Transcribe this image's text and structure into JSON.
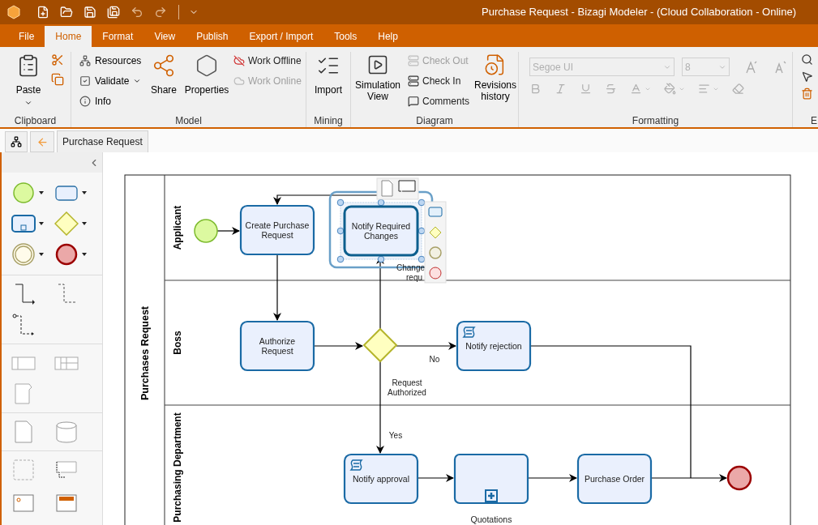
{
  "window": {
    "title": "Purchase Request - Bizagi Modeler - (Cloud Collaboration - Online)"
  },
  "menu_tabs": [
    {
      "label": "File",
      "selected": false
    },
    {
      "label": "Home",
      "selected": true
    },
    {
      "label": "Format",
      "selected": false
    },
    {
      "label": "View",
      "selected": false
    },
    {
      "label": "Publish",
      "selected": false
    },
    {
      "label": "Export / Import",
      "selected": false
    },
    {
      "label": "Tools",
      "selected": false
    },
    {
      "label": "Help",
      "selected": false
    }
  ],
  "ribbon": {
    "clipboard": {
      "label": "Clipboard",
      "paste": "Paste"
    },
    "model": {
      "label": "Model",
      "items": [
        {
          "label": "Resources"
        },
        {
          "label": "Validate"
        },
        {
          "label": "Info"
        }
      ],
      "share": "Share",
      "properties": "Properties",
      "work": [
        {
          "label": "Work Offline",
          "disabled": false
        },
        {
          "label": "Work Online",
          "disabled": true
        }
      ]
    },
    "mining": {
      "label": "Mining",
      "import": "Import"
    },
    "diagram": {
      "label": "Diagram",
      "simulation": "Simulation View",
      "check": [
        {
          "label": "Check Out",
          "disabled": true
        },
        {
          "label": "Check In",
          "disabled": false
        },
        {
          "label": "Comments",
          "disabled": false
        }
      ],
      "revisions": "Revisions history"
    },
    "formatting": {
      "label": "Formatting",
      "font": "Segoe UI",
      "size": "8",
      "disabled": true
    },
    "edit": {
      "label": "E"
    }
  },
  "document_tabs": [
    {
      "label": "Purchase Request",
      "selected": true
    }
  ],
  "diagram": {
    "pool": "Purchases Request",
    "lanes": [
      {
        "label": "Applicant"
      },
      {
        "label": "Boss"
      },
      {
        "label": "Purchasing Department"
      }
    ],
    "elements": [
      {
        "kind": "start"
      },
      {
        "kind": "task",
        "lines": [
          "Create Purchase",
          "Request"
        ],
        "script": false,
        "selected": false
      },
      {
        "kind": "task",
        "lines": [
          "Notify Required",
          "Changes"
        ],
        "script": false,
        "selected": true
      },
      {
        "kind": "task",
        "lines": [
          "Authorize",
          "Request"
        ],
        "script": false,
        "selected": false
      },
      {
        "kind": "gateway"
      },
      {
        "kind": "task",
        "lines": [
          "Notify rejection"
        ],
        "script": true,
        "selected": false
      },
      {
        "kind": "task",
        "lines": [
          "Notify approval"
        ],
        "script": true,
        "selected": false
      },
      {
        "kind": "subprocess",
        "lines": [
          "Quotations"
        ],
        "selected": false
      },
      {
        "kind": "task",
        "lines": [
          "Purchase Order"
        ],
        "script": false,
        "selected": false
      },
      {
        "kind": "end"
      }
    ],
    "flow_labels": [
      {
        "lines": [
          "Change",
          "requ"
        ]
      },
      {
        "lines": [
          "No"
        ]
      },
      {
        "lines": [
          "Request",
          "Authorized"
        ]
      },
      {
        "lines": [
          "Yes"
        ]
      }
    ]
  }
}
